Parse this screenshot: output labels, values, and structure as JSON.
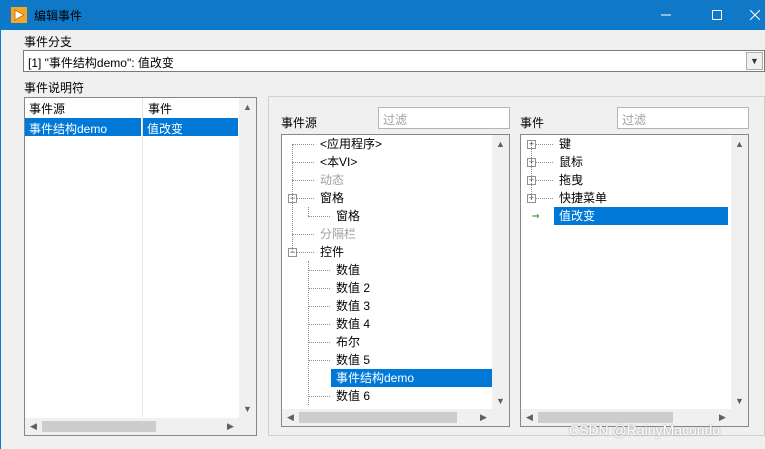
{
  "window": {
    "title": "编辑事件",
    "icons": {
      "app": "labview-arrow-icon",
      "minimize": "minimize-icon",
      "maximize": "maximize-icon",
      "close": "close-icon"
    },
    "colors": {
      "titlebar": "#0f78c7",
      "selection": "#0078d7"
    }
  },
  "event_branch": {
    "label": "事件分支",
    "value": "[1] \"事件结构demo\": 值改变"
  },
  "event_specifiers": {
    "label": "事件说明符",
    "columns": [
      "事件源",
      "事件"
    ],
    "rows": [
      {
        "source": "事件结构demo",
        "event": "值改变",
        "selected": true
      }
    ]
  },
  "event_sources": {
    "label": "事件源",
    "filter_placeholder": "过滤",
    "items": [
      {
        "label": "<应用程序>",
        "level": 0,
        "disabled": false,
        "expander": ""
      },
      {
        "label": "<本VI>",
        "level": 0,
        "disabled": false,
        "expander": ""
      },
      {
        "label": "动态",
        "level": 0,
        "disabled": true,
        "expander": ""
      },
      {
        "label": "窗格",
        "level": 0,
        "disabled": false,
        "expander": "−"
      },
      {
        "label": "窗格",
        "level": 1,
        "disabled": false,
        "expander": ""
      },
      {
        "label": "分隔栏",
        "level": 0,
        "disabled": true,
        "expander": ""
      },
      {
        "label": "控件",
        "level": 0,
        "disabled": false,
        "expander": "−"
      },
      {
        "label": "数值",
        "level": 1,
        "disabled": false,
        "expander": ""
      },
      {
        "label": "数值 2",
        "level": 1,
        "disabled": false,
        "expander": ""
      },
      {
        "label": "数值 3",
        "level": 1,
        "disabled": false,
        "expander": ""
      },
      {
        "label": "数值 4",
        "level": 1,
        "disabled": false,
        "expander": ""
      },
      {
        "label": "布尔",
        "level": 1,
        "disabled": false,
        "expander": ""
      },
      {
        "label": "数值 5",
        "level": 1,
        "disabled": false,
        "expander": ""
      },
      {
        "label": "事件结构demo",
        "level": 1,
        "disabled": false,
        "expander": "",
        "selected": true
      },
      {
        "label": "数值 6",
        "level": 1,
        "disabled": false,
        "expander": ""
      }
    ]
  },
  "events": {
    "label": "事件",
    "filter_placeholder": "过滤",
    "items": [
      {
        "label": "键",
        "expander": "+"
      },
      {
        "label": "鼠标",
        "expander": "+"
      },
      {
        "label": "拖曳",
        "expander": "+"
      },
      {
        "label": "快捷菜单",
        "expander": "+"
      },
      {
        "label": "值改变",
        "expander": "",
        "selected": true
      }
    ]
  },
  "watermark": "CSDN @RainyMacondo"
}
